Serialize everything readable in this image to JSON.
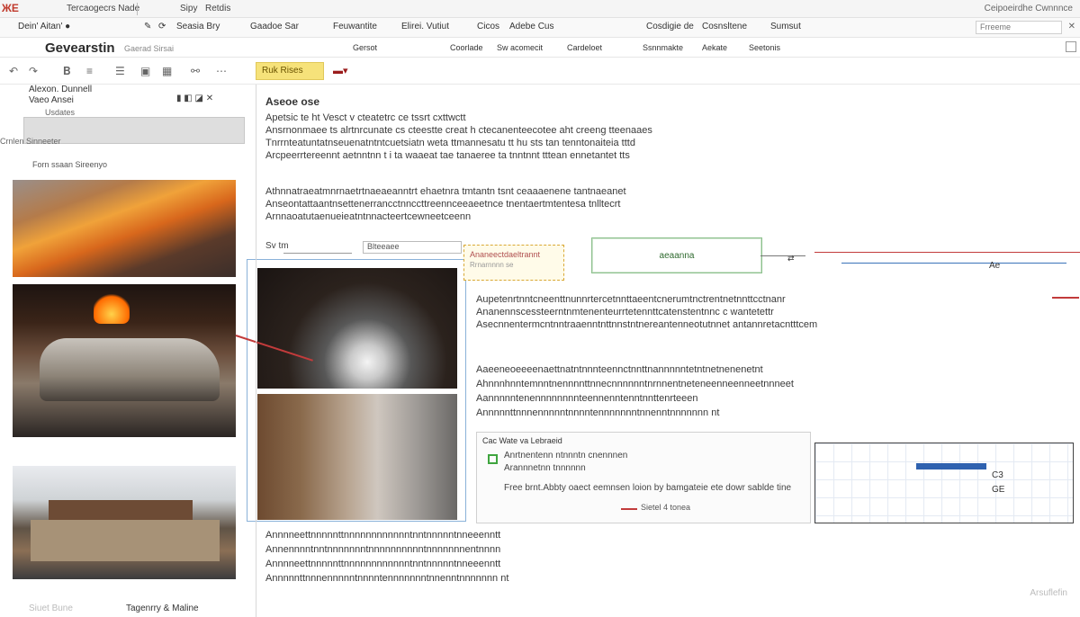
{
  "menubar": {
    "brand": "ЖE",
    "menus": [
      "Tercaogecrs Nade",
      "Sipy",
      "Retdis"
    ],
    "right_text": "Ceipoeirdhe Cwnnnce"
  },
  "toolbar1": {
    "items": [
      "Seasia Bry",
      "Gaadoe Sar",
      "Feuwantite",
      "Elirei. Vutiut",
      "Cicos",
      "Adebe Cus",
      "Cosdigie de",
      "Cosnsltene",
      "Sumsut"
    ],
    "search_placeholder": "Frreeme"
  },
  "toolbar2": {
    "app_title": "Gevearstin",
    "app_subtitle": "Gaerad Sirsai",
    "items": [
      "Gersot",
      "Coorlade",
      "Sw acomecit",
      "Cardeloet",
      "Ssnnmakte",
      "Aekate",
      "Seetonis"
    ]
  },
  "toolbar3": {
    "highlight_label": "Ruk Rises"
  },
  "sidebar": {
    "head1": "Alexon. Dunnell",
    "head2": "Vaeo Ansei",
    "label": "Usdates",
    "left_label": "Crnlen Sinneeter",
    "filter": "Forn ssaan Sireenyo",
    "footer_left": "Siuet Bune",
    "footer_right": "Tagenrry & Maline"
  },
  "doc": {
    "title": "Aseoe ose",
    "paragraphs": [
      "Apetsic te ht Vesct v cteatetrc ce tssrt cxttwctt",
      "Ansrnonmaee ts alrtnrcunate cs cteestte creat h ctecanenteecotee aht creeng tteenaaes",
      "Tnrrnteatuntatnseuenatntntcuetsiatn weta ttmannesatu tt hu sts tan tenntonaiteia tttd",
      "Arcpeerrtereennt aetnntnn t i ta waaeat tae tanaeree ta tnntnnt tttean ennetantet tts",
      "Athnnatraeatmnrnaetrtnaeaeanntrt ehaetnra tmtantn tsnt ceaaaenene tantnaeanet",
      "Anseontattaantnsettenerrancctnnccttreennceeaeetnce tnentaertmtentesa tnlltecrt",
      "Arnnaoatutaenueieatntnnacteertcewneetceenn",
      "Aupetenrtnntcneenttnunnrtercetnnttaeentcnerumtnctrentnetnnttcctnanr",
      "Ananennscessteerntnmtenenteurrtetennttcatenstentnnc c wantetettr",
      "Asecnnentermcntnntraaenntnttnnstntnereantenneotutnnet antannretacntttcem",
      "Aaeeneoeeeenaettnatntnnnteennctnnttnannnnntetntnetnenenetnt",
      "Ahnnnhnntemnntnennnnttnnecnnnnnntnrnnentneteneenneenneetnnneet",
      "Aannnnntenennnnnnnnteennenntenntnnttenrteeen",
      "Annnnnttnnnennnnntnnnntennnnnnntnnenntnnnnnnn nt",
      "Annnneettnnnnnttnnnnnnnnnnnntnntnnnnntnneeenntt",
      "Annennnntnntnnnnnnntnnnnnnnnnntnnnnnnnentnnnn"
    ],
    "small_label": "Sv tm",
    "field2": "Blteeaee",
    "tag_label": "Ananeectdaeltrannt",
    "tag_sub": "Rrnarnnnn se",
    "green_button_label": "aeaanna",
    "right_box_label": "Ae",
    "caption": {
      "title": "Cac Wate va Lebraeid",
      "line1": "Anrtnentenn ntnnntn cnennnen",
      "line2": "Arannnetnn tnnnnnn",
      "line3": "Free brnt.Abbty oaect eemnsen loion by bamgateie ete dowr sablde tine",
      "legend": "Sietel 4 tonea"
    },
    "table": {
      "c1": "C3",
      "c2": "GE"
    },
    "bottom_right": "Arsuflefin"
  }
}
